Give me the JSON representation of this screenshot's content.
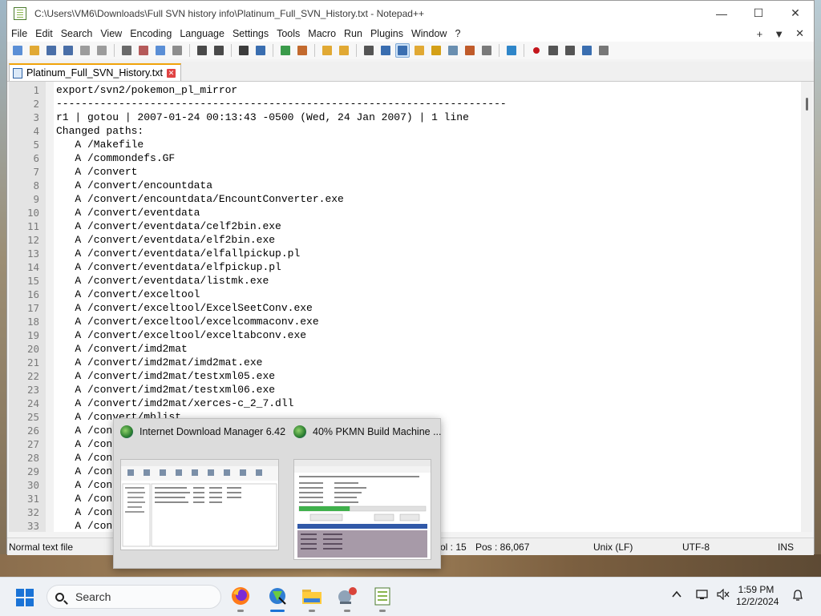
{
  "window": {
    "title": "C:\\Users\\VM6\\Downloads\\Full SVN history info\\Platinum_Full_SVN_History.txt - Notepad++",
    "minimize": "—",
    "maximize": "☐",
    "close": "✕"
  },
  "menu": {
    "items": [
      "File",
      "Edit",
      "Search",
      "View",
      "Encoding",
      "Language",
      "Settings",
      "Tools",
      "Macro",
      "Run",
      "Plugins",
      "Window",
      "?"
    ],
    "right": [
      "+",
      "▼",
      "✕"
    ]
  },
  "toolbar_icons": [
    "new-file-icon",
    "open-file-icon",
    "save-icon",
    "save-all-icon",
    "close-icon",
    "close-all-icon",
    "print-icon",
    "cut-icon",
    "copy-icon",
    "paste-icon",
    "undo-icon",
    "redo-icon",
    "find-icon",
    "replace-icon",
    "zoom-in-icon",
    "zoom-out-icon",
    "sync-vertical-icon",
    "sync-horizontal-icon",
    "word-wrap-icon",
    "show-all-chars-icon",
    "indent-guide-icon",
    "user-language-icon",
    "doc-map-icon",
    "function-list-icon",
    "folder-workspace-icon",
    "document-list-icon",
    "monitoring-icon",
    "record-macro-icon",
    "stop-macro-icon",
    "play-macro-icon",
    "run-macro-multiple-icon",
    "save-macro-icon"
  ],
  "tab": {
    "label": "Platinum_Full_SVN_History.txt",
    "close": "✕"
  },
  "editor": {
    "lines": [
      {
        "n": "1",
        "text": "export/svn2/pokemon_pl_mirror"
      },
      {
        "n": "2",
        "text": "------------------------------------------------------------------------"
      },
      {
        "n": "3",
        "text": "r1 | gotou | 2007-01-24 00:13:43 -0500 (Wed, 24 Jan 2007) | 1 line"
      },
      {
        "n": "4",
        "text": "Changed paths:"
      },
      {
        "n": "5",
        "text": "   A /Makefile"
      },
      {
        "n": "6",
        "text": "   A /commondefs.GF"
      },
      {
        "n": "7",
        "text": "   A /convert"
      },
      {
        "n": "8",
        "text": "   A /convert/encountdata"
      },
      {
        "n": "9",
        "text": "   A /convert/encountdata/EncountConverter.exe"
      },
      {
        "n": "10",
        "text": "   A /convert/eventdata"
      },
      {
        "n": "11",
        "text": "   A /convert/eventdata/celf2bin.exe"
      },
      {
        "n": "12",
        "text": "   A /convert/eventdata/elf2bin.exe"
      },
      {
        "n": "13",
        "text": "   A /convert/eventdata/elfallpickup.pl"
      },
      {
        "n": "14",
        "text": "   A /convert/eventdata/elfpickup.pl"
      },
      {
        "n": "15",
        "text": "   A /convert/eventdata/listmk.exe"
      },
      {
        "n": "16",
        "text": "   A /convert/exceltool"
      },
      {
        "n": "17",
        "text": "   A /convert/exceltool/ExcelSeetConv.exe"
      },
      {
        "n": "18",
        "text": "   A /convert/exceltool/excelcommaconv.exe"
      },
      {
        "n": "19",
        "text": "   A /convert/exceltool/exceltabconv.exe"
      },
      {
        "n": "20",
        "text": "   A /convert/imd2mat"
      },
      {
        "n": "21",
        "text": "   A /convert/imd2mat/imd2mat.exe"
      },
      {
        "n": "22",
        "text": "   A /convert/imd2mat/testxml05.exe"
      },
      {
        "n": "23",
        "text": "   A /convert/imd2mat/testxml06.exe"
      },
      {
        "n": "24",
        "text": "   A /convert/imd2mat/xerces-c_2_7.dll"
      },
      {
        "n": "25",
        "text": "   A /convert/mblist"
      },
      {
        "n": "26",
        "text": "   A /con"
      },
      {
        "n": "27",
        "text": "   A /con"
      },
      {
        "n": "28",
        "text": "   A /con"
      },
      {
        "n": "29",
        "text": "   A /con"
      },
      {
        "n": "30",
        "text": "   A /con"
      },
      {
        "n": "31",
        "text": "   A /con"
      },
      {
        "n": "32",
        "text": "   A /con"
      },
      {
        "n": "33",
        "text": "   A /con"
      }
    ]
  },
  "status": {
    "type": "Normal text file",
    "col": "ol : 15",
    "pos": "Pos : 86,067",
    "eol": "Unix (LF)",
    "encoding": "UTF-8",
    "mode": "INS"
  },
  "popup": {
    "idm_title": "Internet Download Manager 6.42",
    "build_title": "40% PKMN Build Machine ...",
    "build_progress": 0.4
  },
  "taskbar": {
    "search_label": "Search",
    "time": "1:59 PM",
    "date": "12/2/2024",
    "apps": [
      "firefox-icon",
      "idm-icon",
      "file-explorer-icon",
      "network-app-icon",
      "notepad-plus-plus-icon"
    ],
    "tray": [
      "chevron-up-icon",
      "network-icon",
      "volume-muted-icon",
      "notification-bell-icon"
    ]
  }
}
